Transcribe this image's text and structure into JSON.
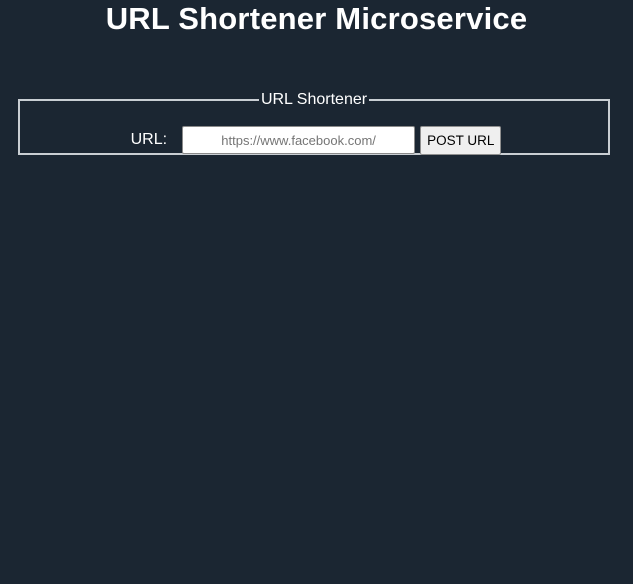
{
  "header": {
    "title": "URL Shortener Microservice"
  },
  "form": {
    "legend": "URL Shortener",
    "url_label": "URL:",
    "url_input": {
      "value": "",
      "placeholder": "https://www.facebook.com/"
    },
    "submit_label": "POST URL"
  },
  "colors": {
    "background": "#1b2632",
    "text": "#ffffff",
    "fieldset_border": "#c9ced3"
  }
}
